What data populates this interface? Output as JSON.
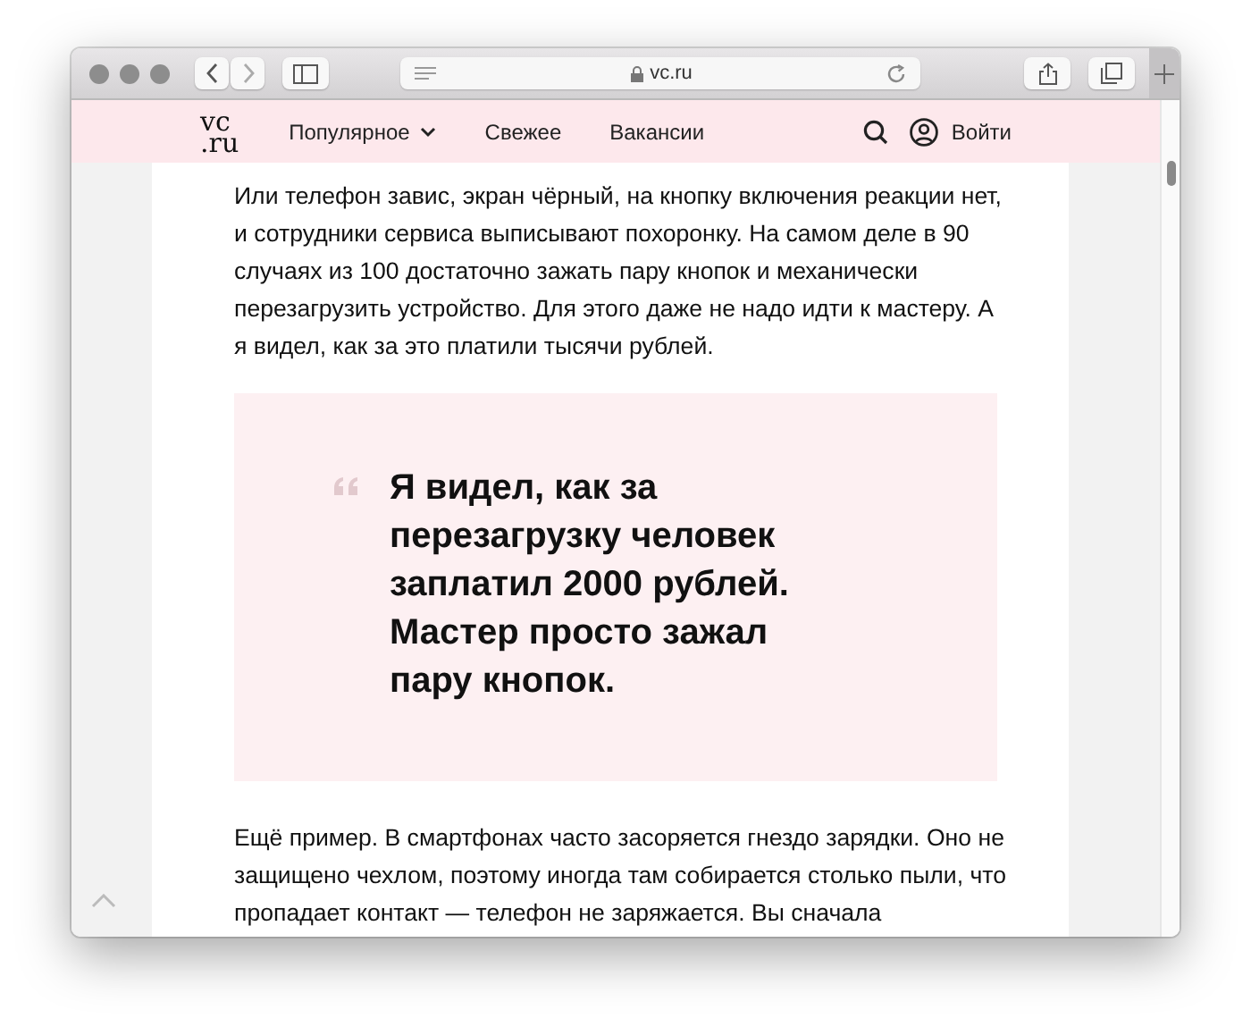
{
  "browser": {
    "address": "vc.ru"
  },
  "site_header": {
    "logo": [
      "vc",
      ".ru"
    ],
    "nav": [
      {
        "label": "Популярное",
        "kind": "dropdown"
      },
      {
        "label": "Свежее",
        "kind": "link"
      },
      {
        "label": "Вакансии",
        "kind": "link"
      }
    ],
    "login": "Войти"
  },
  "article": {
    "paragraph_1": "Или телефон завис, экран чёрный, на кнопку включения реакции нет, и сотрудники сервиса выписывают похоронку. На самом деле в 90 случаях из 100 достаточно зажать пару кнопок и механически перезагрузить устройство. Для этого даже не надо идти к мастеру. А я видел, как за это платили тысячи рублей.",
    "quote": "Я видел, как за перезагрузку человек заплатил 2000 рублей. Мастер просто зажал пару кнопок.",
    "paragraph_2": "Ещё пример. В смартфонах часто засоряется гнездо зарядки. Оно не защищено чехлом, поэтому иногда там собирается столько пыли, что пропадает контакт — телефон не заряжается. Вы сначала"
  }
}
